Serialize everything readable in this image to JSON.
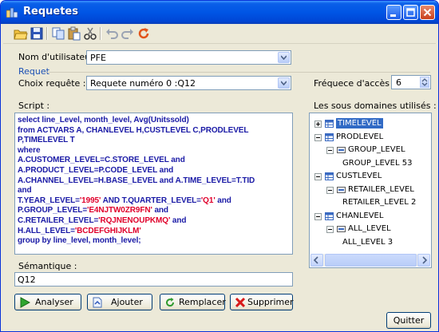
{
  "window": {
    "title": "Requetes"
  },
  "toolbar": {
    "icons": [
      "open-folder-icon",
      "save-icon",
      "copy-icon",
      "paste-icon",
      "cut-icon",
      "undo-icon",
      "redo-icon",
      "refresh-icon"
    ]
  },
  "user": {
    "label": "Nom d'utilisateur :",
    "value": "PFE"
  },
  "group": {
    "title": "Requet"
  },
  "query": {
    "label": "Choix requête :",
    "value": "Requete numéro 0 :Q12"
  },
  "frequency": {
    "label": "Fréquece d'accès :",
    "value": "6"
  },
  "script": {
    "label": "Script :",
    "lines": [
      [
        {
          "t": "select line_Level, month_level, Avg(Unitssold)"
        }
      ],
      [
        {
          "t": "from ACTVARS A, CHANLEVEL H,CUSTLEVEL C,PRODLEVEL"
        }
      ],
      [
        {
          "t": "P,TIMELEVEL T"
        }
      ],
      [
        {
          "t": "where"
        }
      ],
      [
        {
          "t": "A.CUSTOMER_LEVEL=C.STORE_LEVEL and"
        }
      ],
      [
        {
          "t": "A.PRODUCT_LEVEL=P.CODE_LEVEL and"
        }
      ],
      [
        {
          "t": "A.CHANNEL_LEVEL=H.BASE_LEVEL and A.TIME_LEVEL=T.TID"
        }
      ],
      [
        {
          "t": "and"
        }
      ],
      [
        {
          "t": "T.YEAR_LEVEL="
        },
        {
          "t": "'1995'",
          "s": 1
        },
        {
          "t": " AND T.QUARTER_LEVEL="
        },
        {
          "t": "'Q1'",
          "s": 1
        },
        {
          "t": " and"
        }
      ],
      [
        {
          "t": "P.GROUP_LEVEL="
        },
        {
          "t": "'E4NJTW0ZR9FN'",
          "s": 1
        },
        {
          "t": " and"
        }
      ],
      [
        {
          "t": "C.RETAILER_LEVEL="
        },
        {
          "t": "'RQJNENOUPKMQ'",
          "s": 1
        },
        {
          "t": " and"
        }
      ],
      [
        {
          "t": "H.ALL_LEVEL="
        },
        {
          "t": "'BCDEFGHIJKLM'",
          "s": 1
        }
      ],
      [
        {
          "t": "group by line_level, month_level;"
        }
      ]
    ]
  },
  "domains": {
    "label": "Les sous domaines utilisés :",
    "tree": [
      {
        "label": "TIMELEVEL",
        "level": 0,
        "expander": "plus",
        "icon": "table",
        "selected": true
      },
      {
        "label": "PRODLEVEL",
        "level": 0,
        "expander": "minus",
        "icon": "table"
      },
      {
        "label": "GROUP_LEVEL",
        "level": 1,
        "expander": "minus",
        "icon": "column"
      },
      {
        "label": "GROUP_LEVEL 53",
        "level": 2
      },
      {
        "label": "CUSTLEVEL",
        "level": 0,
        "expander": "minus",
        "icon": "table"
      },
      {
        "label": "RETAILER_LEVEL",
        "level": 1,
        "expander": "minus",
        "icon": "column"
      },
      {
        "label": "RETAILER_LEVEL 2",
        "level": 2
      },
      {
        "label": "CHANLEVEL",
        "level": 0,
        "expander": "minus",
        "icon": "table"
      },
      {
        "label": "ALL_LEVEL",
        "level": 1,
        "expander": "minus",
        "icon": "column"
      },
      {
        "label": "ALL_LEVEL 3",
        "level": 2
      }
    ]
  },
  "semantic": {
    "label": "Sémantique :",
    "value": "Q12"
  },
  "buttons": {
    "analyze": "Analyser",
    "add": "Ajouter",
    "replace": "Remplacer",
    "delete": "Supprimer",
    "quit": "Quitter"
  },
  "colors": {
    "keyword": "#1a1aa6",
    "string": "#e0002b",
    "selection": "#316ac5",
    "titlebar": "#0055e5"
  }
}
